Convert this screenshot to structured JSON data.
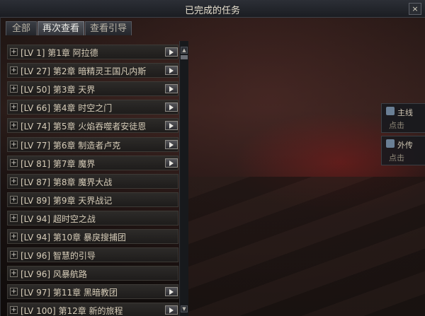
{
  "window": {
    "title": "已完成的任务",
    "close_label": "×"
  },
  "tabs": [
    {
      "label": "全部",
      "active": false
    },
    {
      "label": "再次查看",
      "active": true
    },
    {
      "label": "查看引导",
      "active": false
    }
  ],
  "quests": [
    {
      "label": "[LV 1] 第1章 阿拉德",
      "play": true
    },
    {
      "label": "[LV 27] 第2章 暗精灵王国凡内斯",
      "play": true
    },
    {
      "label": "[LV 50] 第3章 天界",
      "play": true
    },
    {
      "label": "[LV 66] 第4章 时空之门",
      "play": true
    },
    {
      "label": "[LV 74] 第5章 火焰吞噬者安徒恩",
      "play": true
    },
    {
      "label": "[LV 77] 第6章 制造者卢克",
      "play": true
    },
    {
      "label": "[LV 81] 第7章 魔界",
      "play": true
    },
    {
      "label": "[LV 87] 第8章 魔界大战",
      "play": false
    },
    {
      "label": "[LV 89] 第9章 天界战记",
      "play": false
    },
    {
      "label": "[LV 94] 超时空之战",
      "play": false
    },
    {
      "label": "[LV 94] 第10章 暴戾搜捕团",
      "play": false
    },
    {
      "label": "[LV 96] 智慧的引导",
      "play": false
    },
    {
      "label": "[LV 96] 风暴航路",
      "play": false
    },
    {
      "label": "[LV 97] 第11章 黑暗教团",
      "play": true
    },
    {
      "label": "[LV 100] 第12章 新的旅程",
      "play": true
    }
  ],
  "background_panels": [
    {
      "title": "主线",
      "sub": "点击"
    },
    {
      "title": "外传",
      "sub": "点击"
    }
  ],
  "icons": {
    "expand": "plus-box-icon",
    "play": "play-icon",
    "scroll_up": "arrow-up-icon",
    "scroll_down": "arrow-down-icon"
  }
}
